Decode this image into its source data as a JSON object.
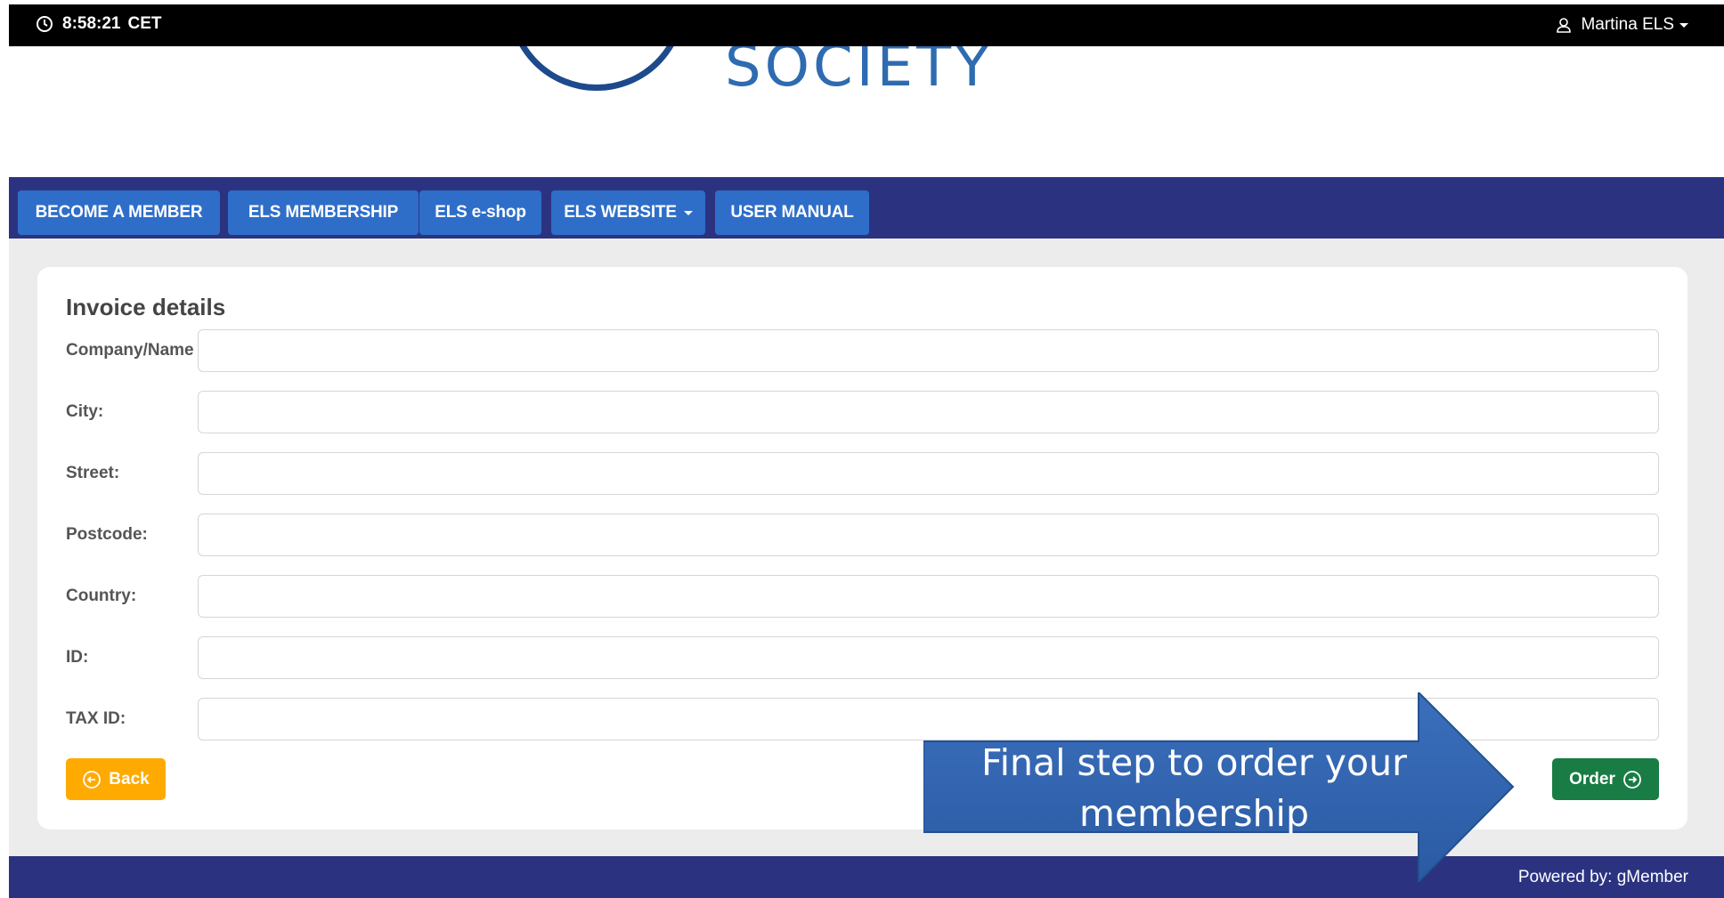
{
  "topbar": {
    "time": "8:58:21",
    "timezone": "CET",
    "user_name": "Martina ELS"
  },
  "logo": {
    "text": "SOCIETY"
  },
  "nav": {
    "items": [
      {
        "label": "BECOME A MEMBER"
      },
      {
        "label": "ELS MEMBERSHIP"
      },
      {
        "label": "ELS e-shop"
      },
      {
        "label": "ELS WEBSITE"
      },
      {
        "label": "USER MANUAL"
      }
    ]
  },
  "form": {
    "title": "Invoice details",
    "fields": [
      {
        "label": "Company/Name",
        "value": ""
      },
      {
        "label": "City:",
        "value": ""
      },
      {
        "label": "Street:",
        "value": ""
      },
      {
        "label": "Postcode:",
        "value": ""
      },
      {
        "label": "Country:",
        "value": ""
      },
      {
        "label": "ID:",
        "value": ""
      },
      {
        "label": "TAX ID:",
        "value": ""
      }
    ],
    "back_label": "Back",
    "order_label": "Order"
  },
  "callout": {
    "text_line1": "Final step to order your",
    "text_line2": "membership"
  },
  "footer": {
    "powered_by": "Powered by:  gMember"
  },
  "colors": {
    "nav_background": "#2b3381",
    "nav_button": "#2e6ec9",
    "back_button": "#ffaa00",
    "order_button": "#1a7c45",
    "callout": "#2f62ad"
  },
  "icons": {
    "clock": "clock-icon",
    "user": "user-icon",
    "back": "arrow-left-circle-icon",
    "order": "arrow-right-circle-icon"
  }
}
